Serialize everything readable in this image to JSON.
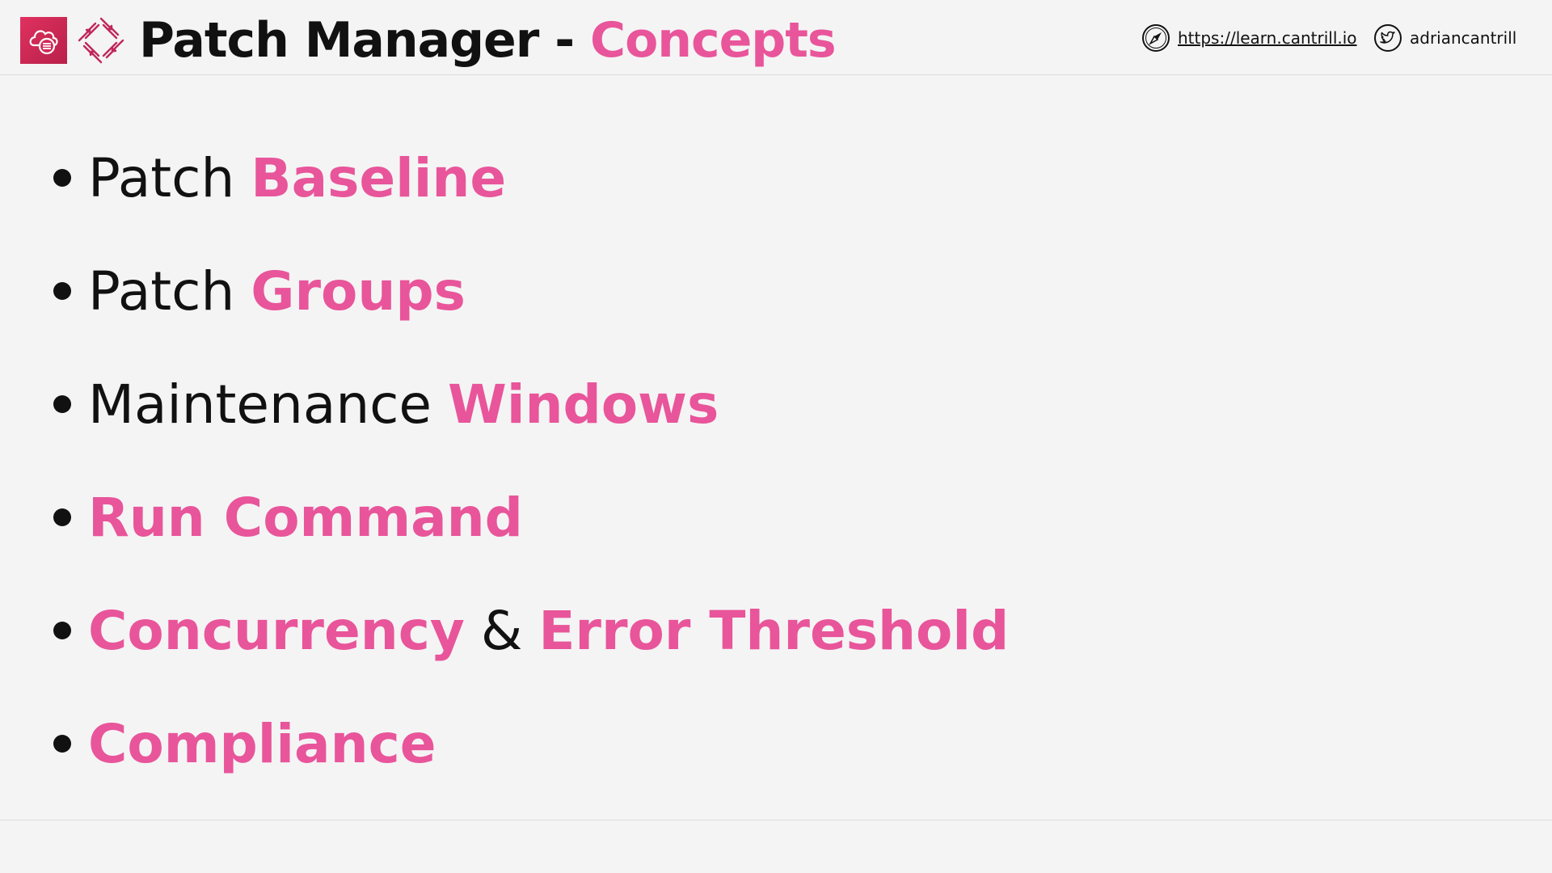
{
  "header": {
    "title_main": "Patch Manager",
    "title_separator": "-",
    "title_accent": "Concepts",
    "website_link": "https://learn.cantrill.io",
    "twitter_handle": "adriancantrill"
  },
  "bullets": [
    {
      "normal": "Patch",
      "accent": "Baseline"
    },
    {
      "normal": "Patch",
      "accent": "Groups"
    },
    {
      "normal": "Maintenance",
      "accent": "Windows"
    },
    {
      "accent": "Run Command"
    },
    {
      "accent": "Concurrency",
      "joiner": "&",
      "accent2": "Error Threshold"
    },
    {
      "accent": "Compliance"
    }
  ],
  "icons": {
    "aws_service": "systems-manager-icon",
    "patch_manager": "patch-manager-icon",
    "website": "compass-icon",
    "twitter": "twitter-icon"
  },
  "colors": {
    "accent": "#e8559a",
    "text": "#111111",
    "background": "#f4f4f4",
    "aws_icon": "#d12b58"
  }
}
